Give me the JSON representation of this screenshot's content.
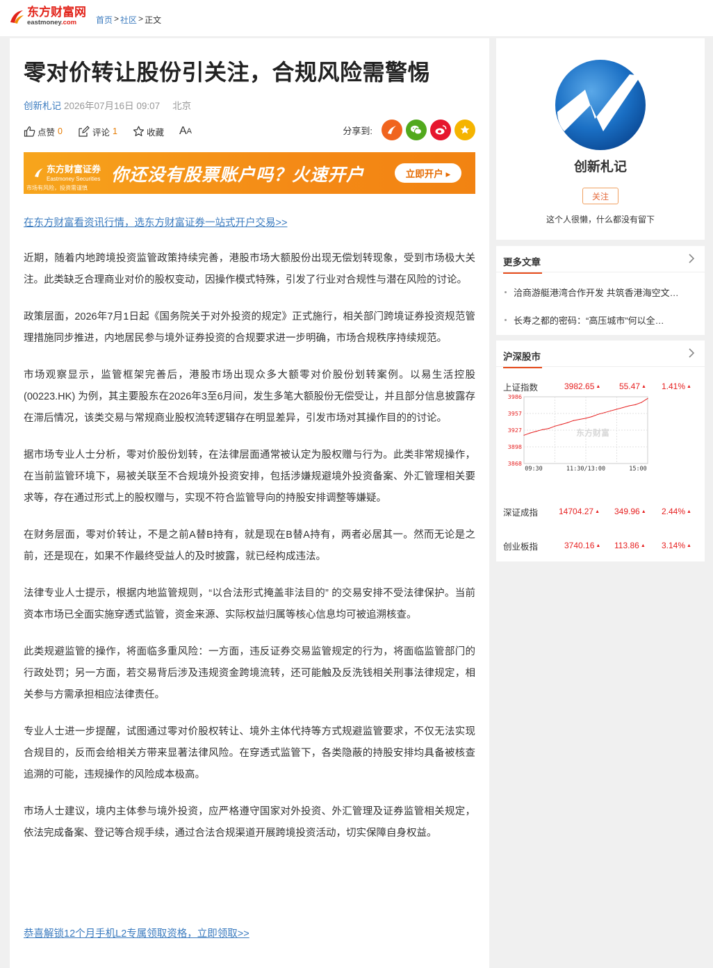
{
  "topbar": {
    "logo_cn": "东方财富网",
    "logo_en_a": "eastmoney",
    "logo_en_b": ".com",
    "breadcrumb": [
      {
        "label": "首页",
        "link": true
      },
      {
        "label": ">",
        "link": false
      },
      {
        "label": "社区",
        "link": true
      },
      {
        "label": ">",
        "link": false
      },
      {
        "label": "正文",
        "link": false
      }
    ]
  },
  "article": {
    "title": "零对价转让股份引关注，合规风险需警惕",
    "author": "创新札记",
    "datetime": "2026年07月16日 09:07",
    "location": "北京",
    "actions": {
      "like_label": "点赞",
      "like_count": "0",
      "comment_label": "评论",
      "comment_count": "1",
      "favorite_label": "收藏",
      "font_label_big": "A",
      "font_label_small": "A"
    },
    "share_label": "分享到:",
    "banner": {
      "logo": "东方财富证券",
      "logo_sub": "Eastmoney Securities",
      "warning": "市场有风险，投资需谨慎",
      "headline": "你还没有股票账户吗？火速开户",
      "button": "立即开户 ▸"
    },
    "promo_top": "在东方财富看资讯行情，选东方财富证券一站式开户交易>>",
    "paragraphs": [
      "近期，随着内地跨境投资监管政策持续完善，港股市场大额股份出现无偿划转现象，受到市场极大关注。此类缺乏合理商业对价的股权变动，因操作模式特殊，引发了行业对合规性与潜在风险的讨论。",
      " 政策层面，2026年7月1日起《国务院关于对外投资的规定》正式施行，相关部门跨境证券投资规范管理措施同步推进，内地居民参与境外证券投资的合规要求进一步明确，市场合规秩序持续规范。",
      " 市场观察显示，监管框架完善后，港股市场出现众多大额零对价股份划转案例。以易生活控股(00223.HK) 为例，其主要股东在2026年3至6月间，发生多笔大额股份无偿受让，并且部分信息披露存在滞后情况，该类交易与常规商业股权流转逻辑存在明显差异，引发市场对其操作目的的讨论。",
      " 据市场专业人士分析，零对价股份划转，在法律层面通常被认定为股权赠与行为。此类非常规操作，在当前监管环境下，易被关联至不合规境外投资安排，包括涉嫌规避境外投资备案、外汇管理相关要求等，存在通过形式上的股权赠与，实现不符合监管导向的持股安排调整等嫌疑。",
      " 在财务层面，零对价转让，不是之前A替B持有，就是现在B替A持有，两者必居其一。然而无论是之前，还是现在，如果不作最终受益人的及时披露，就已经构成违法。",
      " 法律专业人士提示，根据内地监管规则，“以合法形式掩盖非法目的” 的交易安排不受法律保护。当前资本市场已全面实施穿透式监管，资金来源、实际权益归属等核心信息均可被追溯核查。",
      " 此类规避监管的操作，将面临多重风险：一方面，违反证券交易监管规定的行为，将面临监管部门的行政处罚；另一方面，若交易背后涉及违规资金跨境流转，还可能触及反洗钱相关刑事法律规定，相关参与方需承担相应法律责任。",
      " 专业人士进一步提醒，试图通过零对价股权转让、境外主体代持等方式规避监管要求，不仅无法实现合规目的，反而会给相关方带来显著法律风险。在穿透式监管下，各类隐蔽的持股安排均具备被核查追溯的可能，违规操作的风险成本极高。",
      " 市场人士建议，境内主体参与境外投资，应严格遵守国家对外投资、外汇管理及证券监管相关规定，依法完成备案、登记等合规手续，通过合法合规渠道开展跨境投资活动，切实保障自身权益。"
    ],
    "promo_bottom": "恭喜解锁12个月手机L2专属领取资格，立即领取>>"
  },
  "sidebar": {
    "author_name": "创新札记",
    "follow_label": "关注",
    "bio": "这个人很懒，什么都没有留下",
    "more_title": "更多文章",
    "more_items": [
      "洽商游艇港湾合作开发 共筑香港海空文…",
      "长寿之都的密码：“高压城市”何以全…"
    ],
    "market_title": "沪深股市",
    "indices": [
      {
        "name": "上证指数",
        "value": "3982.65",
        "change": "55.47",
        "pct": "1.41%"
      },
      {
        "name": "深证成指",
        "value": "14704.27",
        "change": "349.96",
        "pct": "2.44%"
      },
      {
        "name": "创业板指",
        "value": "3740.16",
        "change": "113.86",
        "pct": "3.14%"
      }
    ],
    "colors": {
      "up": "#e62020",
      "accent": "#e64a19",
      "link": "#3b7bbf"
    }
  },
  "chart_data": {
    "type": "line",
    "watermark": "东方财富",
    "y_ticks": [
      "3986",
      "3957",
      "3927",
      "3898",
      "3868"
    ],
    "ylim": [
      3868,
      3986
    ],
    "x_ticks": [
      "09:30",
      "11:30/13:00",
      "15:00"
    ],
    "x": [
      0,
      12,
      24,
      36,
      48,
      60,
      72,
      84,
      96,
      108,
      120,
      132,
      144,
      156,
      168,
      180,
      192,
      204,
      216,
      228,
      240
    ],
    "series": [
      {
        "values": [
          3918,
          3922,
          3925,
          3928,
          3930,
          3934,
          3937,
          3940,
          3944,
          3946,
          3948,
          3951,
          3955,
          3958,
          3961,
          3964,
          3967,
          3970,
          3972,
          3976,
          3983
        ]
      }
    ]
  }
}
